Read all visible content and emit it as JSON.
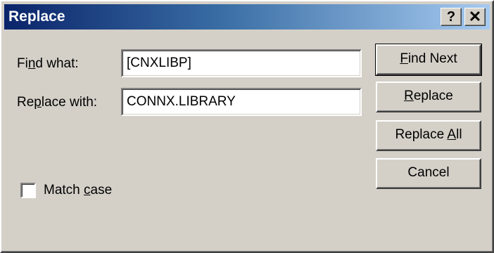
{
  "window": {
    "title": "Replace",
    "help_label": "?",
    "close_label": "✕"
  },
  "form": {
    "find_label": "Find what:",
    "find_value": "[CNXLIBP]",
    "replace_label": "Replace with:",
    "replace_value": "CONNX.LIBRARY",
    "match_case_label": "Match case",
    "match_case_checked": false
  },
  "buttons": {
    "find_next": "Find Next",
    "replace": "Replace",
    "replace_all": "Replace All",
    "cancel": "Cancel"
  },
  "colors": {
    "titlebar_start": "#0a246a",
    "titlebar_end": "#a6caf0",
    "face": "#d4d0c8"
  }
}
